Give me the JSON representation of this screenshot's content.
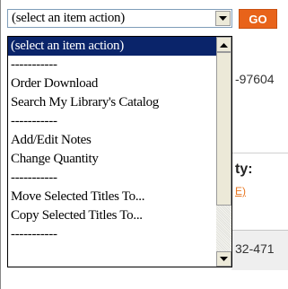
{
  "select": {
    "value": "(select an item action)"
  },
  "go_button": {
    "label": "GO"
  },
  "list": {
    "items": [
      {
        "label": "(select an item action)",
        "selected": true
      },
      {
        "label": "-----------"
      },
      {
        "label": "Order Download"
      },
      {
        "label": "Search My Library's Catalog"
      },
      {
        "label": "-----------"
      },
      {
        "label": "Add/Edit Notes"
      },
      {
        "label": "Change Quantity"
      },
      {
        "label": "-----------"
      },
      {
        "label": "Move Selected Titles To..."
      },
      {
        "label": "Copy Selected Titles To..."
      },
      {
        "label": "-----------"
      }
    ]
  },
  "background": {
    "isbn_fragment_1": "-97604",
    "quantity_fragment": "ty:",
    "link_fragment": "E)",
    "isbn_fragment_2": "32-471"
  },
  "icons": {
    "dropdown_arrow": "chevron-down-icon",
    "scroll_up": "scroll-up-icon",
    "scroll_down": "scroll-down-icon"
  },
  "colors": {
    "go_button": "#e8631a",
    "selection": "#0a246a",
    "link": "#e87722"
  }
}
